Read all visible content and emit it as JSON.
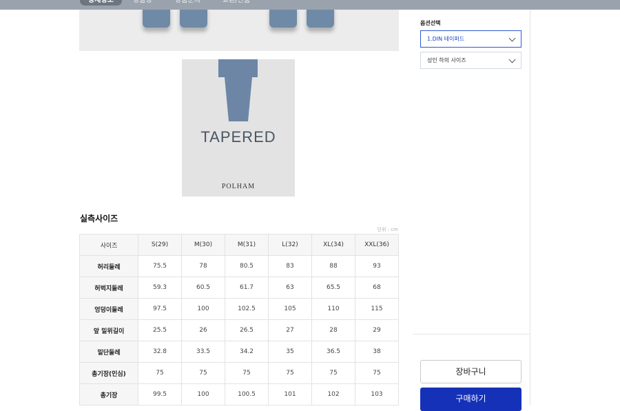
{
  "tabs": [
    "상세정보",
    "상품평",
    "상품문의",
    "교환/반품"
  ],
  "product": {
    "fit_word": "TAPERED",
    "brand": "POLHAM"
  },
  "size_section": {
    "title": "실측사이즈",
    "unit": "단위 : cm",
    "header": [
      "사이즈",
      "S(29)",
      "M(30)",
      "M(31)",
      "L(32)",
      "XL(34)",
      "XXL(36)"
    ],
    "rows": [
      {
        "label": "허리둘레",
        "values": [
          "75.5",
          "78",
          "80.5",
          "83",
          "88",
          "93"
        ]
      },
      {
        "label": "허벅지둘레",
        "values": [
          "59.3",
          "60.5",
          "61.7",
          "63",
          "65.5",
          "68"
        ]
      },
      {
        "label": "엉덩이둘레",
        "values": [
          "97.5",
          "100",
          "102.5",
          "105",
          "110",
          "115"
        ]
      },
      {
        "label": "앞 밑위길이",
        "values": [
          "25.5",
          "26",
          "26.5",
          "27",
          "28",
          "29"
        ]
      },
      {
        "label": "밑단둘레",
        "values": [
          "32.8",
          "33.5",
          "34.2",
          "35",
          "36.5",
          "38"
        ]
      },
      {
        "label": "총기장(인심)",
        "values": [
          "75",
          "75",
          "75",
          "75",
          "75",
          "75"
        ]
      },
      {
        "label": "총기장",
        "values": [
          "99.5",
          "100",
          "100.5",
          "101",
          "102",
          "103"
        ]
      }
    ]
  },
  "options": {
    "label": "옵션선택",
    "select1": "1.DIN 테이퍼드",
    "select2": "성인 하의 사이즈"
  },
  "actions": {
    "cart": "장바구니",
    "buy": "구매하기"
  },
  "colors": {
    "accent": "#1431b8",
    "tabbar": "#9aa3ad"
  }
}
